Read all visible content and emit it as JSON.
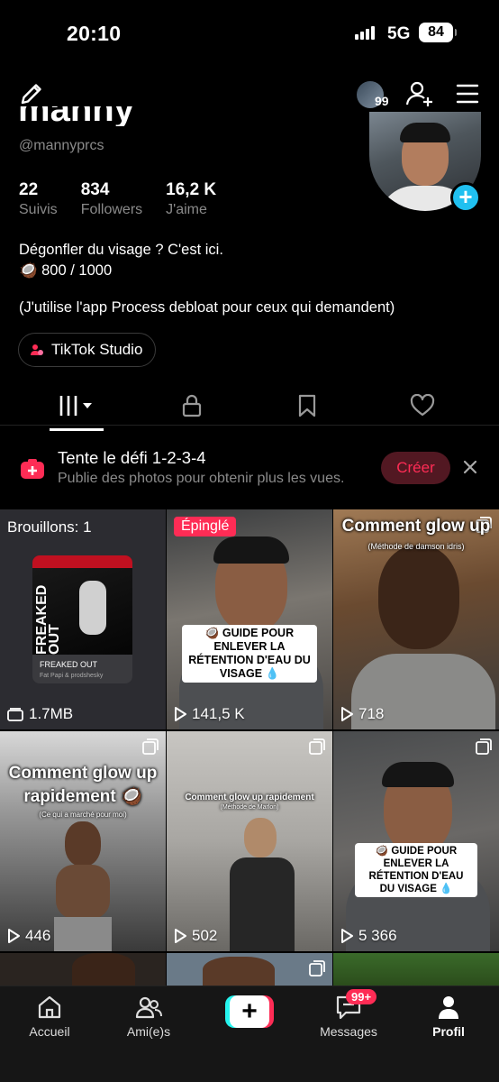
{
  "status_bar": {
    "time": "20:10",
    "network": "5G",
    "battery": "84"
  },
  "header": {
    "friends_count": "99"
  },
  "profile": {
    "name_partial": "manny",
    "handle": "@mannyprcs",
    "stats": [
      {
        "value": "22",
        "label": "Suivis"
      },
      {
        "value": "834",
        "label": "Followers"
      },
      {
        "value": "16,2 K",
        "label": "J'aime"
      }
    ],
    "bio_line1": "Dégonfler du visage ? C'est ici.",
    "bio_line2": "🥥 800 / 1000",
    "bio_line3": "(J'utilise l'app Process debloat pour ceux qui demandent)",
    "studio_label": "TikTok Studio"
  },
  "banner": {
    "title": "Tente le défi 1-2-3-4",
    "subtitle": "Publie des photos pour obtenir plus les vues.",
    "create_label": "Créer"
  },
  "grid": {
    "draft": {
      "title": "Brouillons: 1",
      "size": "1.7MB",
      "card_title": "FREAKED OUT",
      "card_sub": "Fat Papi & prodshesky",
      "art_text": "FREAKED OUT"
    },
    "items": [
      {
        "badge": "Épinglé",
        "caption": "🥥 GUIDE POUR ENLEVER LA RÉTENTION D'EAU DU VISAGE 💧",
        "views": "141,5 K"
      },
      {
        "caption": "Comment glow up",
        "subcaption": "(Méthode de damson idris)",
        "views": "718"
      },
      {
        "caption": "Comment glow up rapidement 🥥",
        "subcaption": "(Ce qui a marché pour moi)",
        "views": "446"
      },
      {
        "caption": "Comment glow up rapidement",
        "subcaption": "(Méthode de Marlon)",
        "views": "502"
      },
      {
        "caption": "🥥 GUIDE POUR ENLEVER LA RÉTENTION D'EAU DU VISAGE 💧",
        "views": "5 366"
      }
    ]
  },
  "nav": {
    "items": [
      {
        "label": "Accueil"
      },
      {
        "label": "Ami(e)s"
      },
      {
        "label": "Messages",
        "badge": "99+"
      },
      {
        "label": "Profil"
      }
    ]
  },
  "colors": {
    "accent": "#fe2c55",
    "cyan": "#25f4ee",
    "muted": "#8a8a8a",
    "blue": "#20c0f0"
  }
}
